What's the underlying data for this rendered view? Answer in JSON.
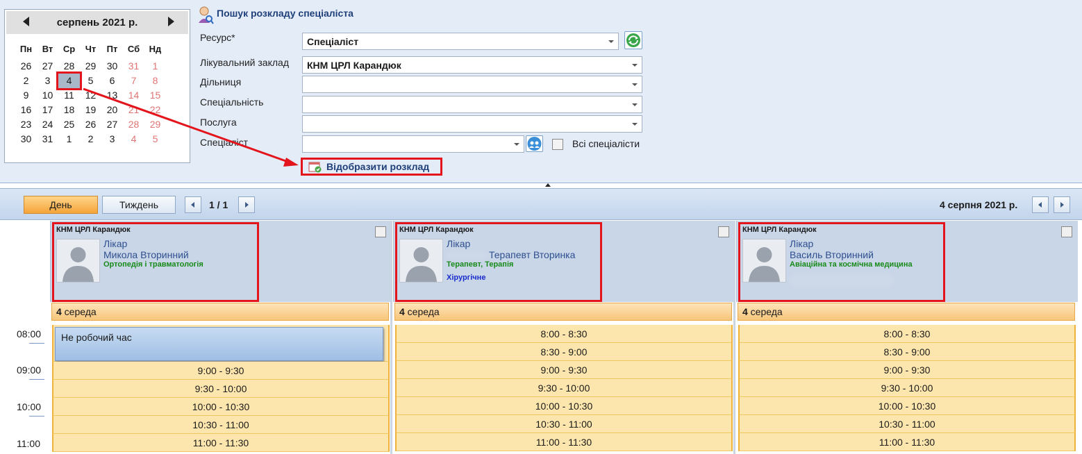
{
  "calendar": {
    "month_label": "серпень 2021 р.",
    "weekdays": [
      "Пн",
      "Вт",
      "Ср",
      "Чт",
      "Пт",
      "Сб",
      "Нд"
    ],
    "weeks": [
      [
        "26",
        "27",
        "28",
        "29",
        "30",
        "31",
        "1"
      ],
      [
        "2",
        "3",
        "4",
        "5",
        "6",
        "7",
        "8"
      ],
      [
        "9",
        "10",
        "11",
        "12",
        "13",
        "14",
        "15"
      ],
      [
        "16",
        "17",
        "18",
        "19",
        "20",
        "21",
        "22"
      ],
      [
        "23",
        "24",
        "25",
        "26",
        "27",
        "28",
        "29"
      ],
      [
        "30",
        "31",
        "1",
        "2",
        "3",
        "4",
        "5"
      ]
    ],
    "selected_day": "4"
  },
  "search": {
    "title": "Пошук розкладу спеціаліста",
    "resource_label": "Ресурс*",
    "resource_value": "Спеціаліст",
    "facility_label": "Лікувальний заклад",
    "facility_value": "КНМ ЦРЛ Карандюк",
    "district_label": "Дільниця",
    "district_value": "",
    "specialty_label": "Спеціальність",
    "specialty_value": "",
    "service_label": "Послуга",
    "service_value": "",
    "specialist_label": "Спеціаліст",
    "specialist_value": "",
    "all_specialists_label": "Всі спеціалісти",
    "show_button_label": "Відобразити розклад"
  },
  "toolbar": {
    "day_label": "День",
    "week_label": "Тиждень",
    "pager": "1 / 1",
    "date": "4 серпня 2021 р."
  },
  "times": [
    "08:00",
    "09:00",
    "10:00",
    "11:00"
  ],
  "columns": [
    {
      "org": "КНМ ЦРЛ Карандюк",
      "role": "Лікар",
      "name": "Микола Вторинний",
      "specialty": "Ортопедія і травматологія",
      "department": "",
      "day_header_num": "4",
      "day_header_text": " середа",
      "nonwork": "Не робочий час",
      "slots": [
        "9:00 - 9:30",
        "9:30 - 10:00",
        "10:00 - 10:30",
        "10:30 - 11:00",
        "11:00 - 11:30"
      ]
    },
    {
      "org": "КНМ ЦРЛ Карандюк",
      "role": "Лікар",
      "name": "Терапевт Вторинка",
      "specialty": "Терапевт, Терапія",
      "department": "Хірургічне",
      "day_header_num": "4",
      "day_header_text": " середа",
      "slots": [
        "8:00 - 8:30",
        "8:30 - 9:00",
        "9:00 - 9:30",
        "9:30 - 10:00",
        "10:00 - 10:30",
        "10:30 - 11:00",
        "11:00 - 11:30"
      ]
    },
    {
      "org": "КНМ ЦРЛ Карандюк",
      "role": "Лікар",
      "name": "Василь Вторинний",
      "specialty": "Авіаційна та космічна медицина",
      "department": "",
      "day_header_num": "4",
      "day_header_text": " середа",
      "slots": [
        "8:00 - 8:30",
        "8:30 - 9:00",
        "9:00 - 9:30",
        "9:30 - 10:00",
        "10:00 - 10:30",
        "10:30 - 11:00",
        "11:00 - 11:30"
      ]
    }
  ],
  "colors": {
    "accent_red": "#e4141c",
    "slot_bg": "#fde6ae",
    "header_bg": "#c8d6e8",
    "link_blue": "#2f4f8f",
    "specialty_green": "#188a18"
  }
}
